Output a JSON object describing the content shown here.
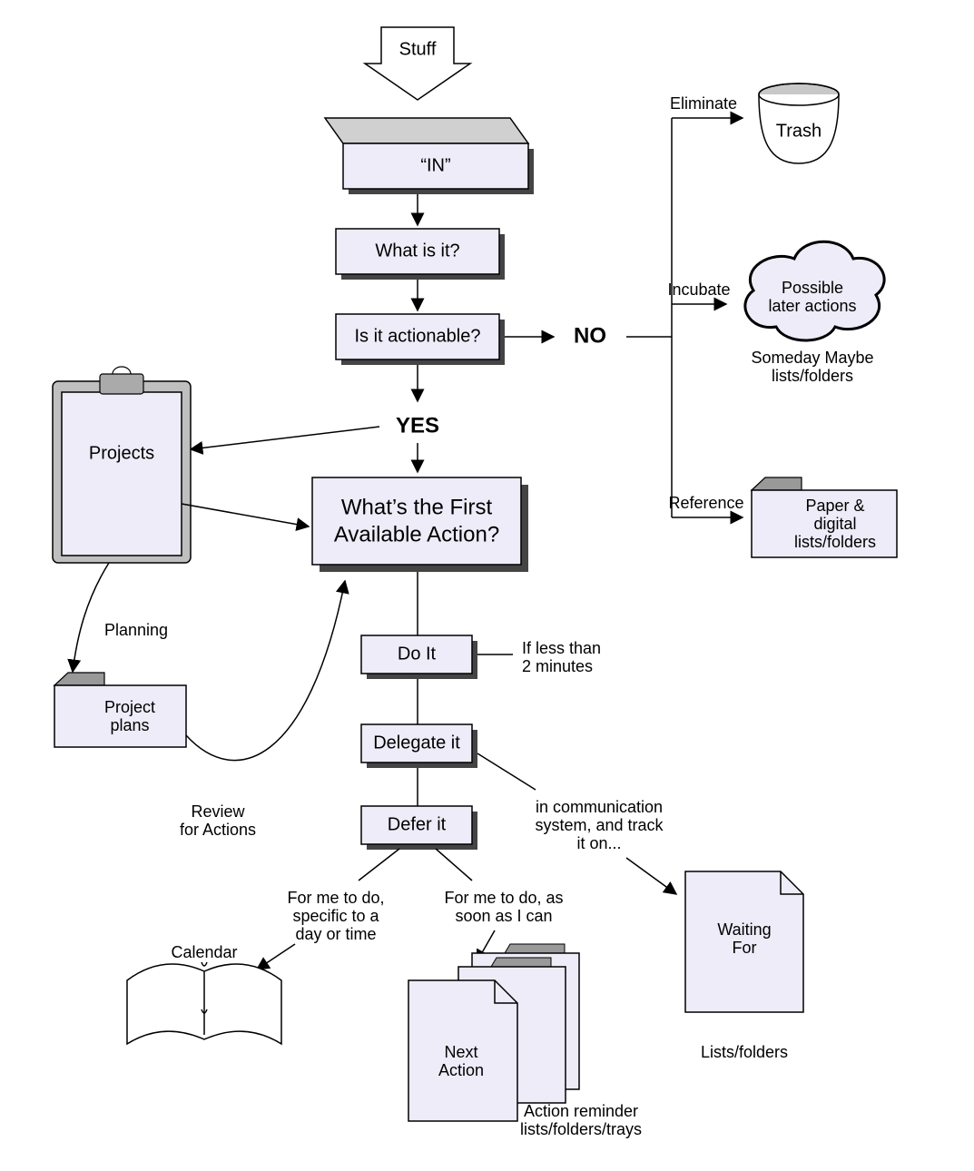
{
  "nodes": {
    "stuff": "Stuff",
    "in": "“IN”",
    "what_is_it": "What is it?",
    "actionable": "Is it actionable?",
    "no": "NO",
    "yes": "YES",
    "first_action_l1": "What’s the First",
    "first_action_l2": "Available Action?",
    "do_it": "Do It",
    "delegate": "Delegate it",
    "defer": "Defer it",
    "projects": "Projects",
    "project_plans_l1": "Project",
    "project_plans_l2": "plans",
    "calendar": "Calendar",
    "next_action_l1": "Next",
    "next_action_l2": "Action",
    "waiting_l1": "Waiting",
    "waiting_l2": "For",
    "trash": "Trash",
    "possible_l1": "Possible",
    "possible_l2": "later actions",
    "paper_l1": "Paper &",
    "paper_l2": "digital",
    "paper_l3": "lists/folders"
  },
  "edges": {
    "eliminate": "Eliminate",
    "incubate": "Incubate",
    "reference": "Reference",
    "someday_l1": "Someday Maybe",
    "someday_l2": "lists/folders",
    "less2_l1": "If less than",
    "less2_l2": "2 minutes",
    "comm_l1": "in communication",
    "comm_l2": "system, and track",
    "comm_l3": "it on...",
    "forme_day_l1": "For me to do,",
    "forme_day_l2": "specific to a",
    "forme_day_l3": "day or time",
    "forme_asap_l1": "For me to do, as",
    "forme_asap_l2": "soon as I can",
    "planning": "Planning",
    "review_l1": "Review",
    "review_l2": "for Actions",
    "lists_folders": "Lists/folders",
    "action_reminder_l1": "Action reminder",
    "action_reminder_l2": "lists/folders/trays"
  }
}
